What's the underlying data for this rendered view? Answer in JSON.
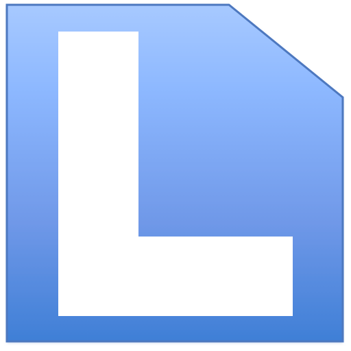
{
  "icon": {
    "name": "L",
    "glyph": "L",
    "colors": {
      "background": "#ffffff",
      "tile_top": "#a7c9ff",
      "tile_upper_mid": "#8db8ff",
      "tile_mid": "#6f98e8",
      "tile_bottom": "#3f7fd6",
      "tile_border": "#4d78bf",
      "letter": "#ffffff",
      "shadow": "#b8c9e6"
    }
  }
}
